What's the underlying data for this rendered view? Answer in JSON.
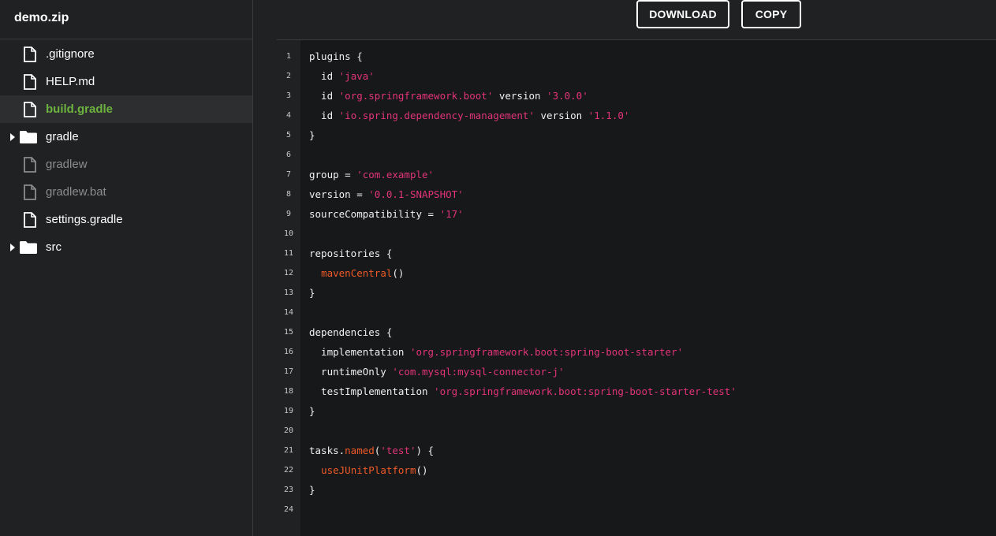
{
  "sidebar": {
    "archive_name": "demo.zip",
    "items": [
      {
        "label": ".gitignore",
        "type": "file",
        "state": "normal"
      },
      {
        "label": "HELP.md",
        "type": "file",
        "state": "normal"
      },
      {
        "label": "build.gradle",
        "type": "file",
        "state": "selected"
      },
      {
        "label": "gradle",
        "type": "folder",
        "state": "collapsed"
      },
      {
        "label": "gradlew",
        "type": "file",
        "state": "dimmed"
      },
      {
        "label": "gradlew.bat",
        "type": "file",
        "state": "dimmed"
      },
      {
        "label": "settings.gradle",
        "type": "file",
        "state": "normal"
      },
      {
        "label": "src",
        "type": "folder",
        "state": "collapsed"
      }
    ]
  },
  "toolbar": {
    "download_label": "DOWNLOAD",
    "copy_label": "COPY"
  },
  "colors": {
    "background": "#1f2122",
    "code_background": "#161819",
    "selected_text": "#6db33f",
    "string": "#e2347a",
    "function": "#f05a28",
    "dimmed_text": "#8a8c8e"
  },
  "editor": {
    "lines": [
      [
        {
          "t": "plugins {",
          "k": "plain"
        }
      ],
      [
        {
          "t": "  id ",
          "k": "plain"
        },
        {
          "t": "'java'",
          "k": "str"
        }
      ],
      [
        {
          "t": "  id ",
          "k": "plain"
        },
        {
          "t": "'org.springframework.boot'",
          "k": "str"
        },
        {
          "t": " version ",
          "k": "plain"
        },
        {
          "t": "'3.0.0'",
          "k": "str"
        }
      ],
      [
        {
          "t": "  id ",
          "k": "plain"
        },
        {
          "t": "'io.spring.dependency-management'",
          "k": "str"
        },
        {
          "t": " version ",
          "k": "plain"
        },
        {
          "t": "'1.1.0'",
          "k": "str"
        }
      ],
      [
        {
          "t": "}",
          "k": "plain"
        }
      ],
      [],
      [
        {
          "t": "group = ",
          "k": "plain"
        },
        {
          "t": "'com.example'",
          "k": "str"
        }
      ],
      [
        {
          "t": "version = ",
          "k": "plain"
        },
        {
          "t": "'0.0.1-SNAPSHOT'",
          "k": "str"
        }
      ],
      [
        {
          "t": "sourceCompatibility = ",
          "k": "plain"
        },
        {
          "t": "'17'",
          "k": "str"
        }
      ],
      [],
      [
        {
          "t": "repositories {",
          "k": "plain"
        }
      ],
      [
        {
          "t": "  ",
          "k": "plain"
        },
        {
          "t": "mavenCentral",
          "k": "fn"
        },
        {
          "t": "()",
          "k": "plain"
        }
      ],
      [
        {
          "t": "}",
          "k": "plain"
        }
      ],
      [],
      [
        {
          "t": "dependencies {",
          "k": "plain"
        }
      ],
      [
        {
          "t": "  implementation ",
          "k": "plain"
        },
        {
          "t": "'org.springframework.boot:spring-boot-starter'",
          "k": "str"
        }
      ],
      [
        {
          "t": "  runtimeOnly ",
          "k": "plain"
        },
        {
          "t": "'com.mysql:mysql-connector-j'",
          "k": "str"
        }
      ],
      [
        {
          "t": "  testImplementation ",
          "k": "plain"
        },
        {
          "t": "'org.springframework.boot:spring-boot-starter-test'",
          "k": "str"
        }
      ],
      [
        {
          "t": "}",
          "k": "plain"
        }
      ],
      [],
      [
        {
          "t": "tasks.",
          "k": "plain"
        },
        {
          "t": "named",
          "k": "fn"
        },
        {
          "t": "(",
          "k": "plain"
        },
        {
          "t": "'test'",
          "k": "str"
        },
        {
          "t": ") {",
          "k": "plain"
        }
      ],
      [
        {
          "t": "  ",
          "k": "plain"
        },
        {
          "t": "useJUnitPlatform",
          "k": "fn"
        },
        {
          "t": "()",
          "k": "plain"
        }
      ],
      [
        {
          "t": "}",
          "k": "plain"
        }
      ],
      []
    ]
  }
}
